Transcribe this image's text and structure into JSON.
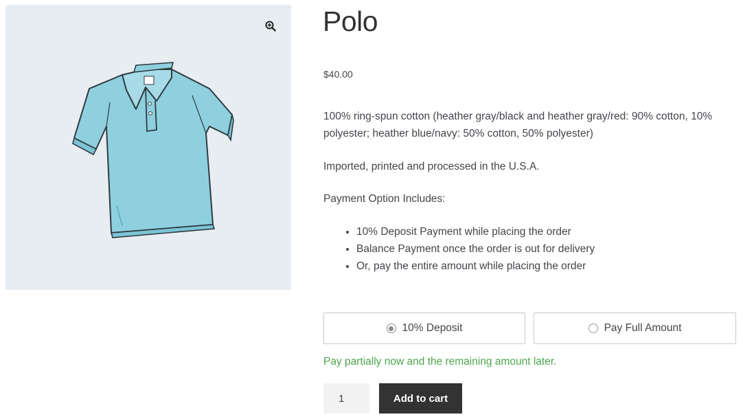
{
  "product": {
    "title": "Polo",
    "price": "$40.00",
    "description": [
      "100% ring-spun cotton (heather gray/black and heather gray/red: 90% cotton, 10% polyester; heather blue/navy: 50% cotton, 50% polyester)",
      "Imported, printed and processed in the U.S.A.",
      "Payment Option Includes:"
    ],
    "payment_points": [
      "10% Deposit Payment while placing the order",
      "Balance Payment once the order is out for delivery",
      "Or, pay the entire amount while placing the order"
    ],
    "image_icon": "polo-shirt-image",
    "zoom_icon": "zoom-in-icon"
  },
  "payment_options": {
    "deposit_label": "10% Deposit",
    "full_label": "Pay Full Amount",
    "selected": "deposit",
    "note": "Pay partially now and the remaining amount later."
  },
  "cart": {
    "quantity": "1",
    "add_label": "Add to cart"
  },
  "colors": {
    "note_green": "#4ca54c",
    "button_dark": "#333333",
    "gallery_bg": "#e8edf2",
    "shirt": "#8fd0df"
  }
}
